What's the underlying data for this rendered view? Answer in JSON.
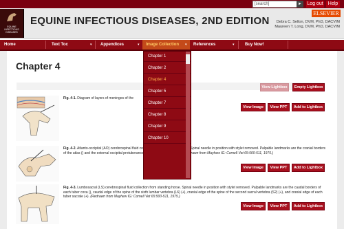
{
  "topbar": {
    "search_placeholder": "[search]",
    "search_go": "►",
    "logout_label": "Log out",
    "help_label": "Help"
  },
  "header": {
    "cover_text": "EQUINE INFECTIOUS DISEASES",
    "title": "EQUINE INFECTIOUS DISEASES, 2ND EDITION",
    "publisher": "ELSEVIER",
    "author1": "Debra C. Sellon, DVM, PhD, DACVIM",
    "author2": "Maureen T. Long, DVM, PhD, DACVIM"
  },
  "nav": {
    "home": "Home",
    "text_toc": "Text Toc",
    "appendices": "Appendices",
    "image_collection": "Image Collection",
    "references": "References",
    "buy_now": "Buy Now!"
  },
  "dropdown": {
    "items": [
      "Chapter 1",
      "Chapter 2",
      "Chapter 4",
      "Chapter 5",
      "Chapter 7",
      "Chapter 8",
      "Chapter 9",
      "Chapter 10"
    ]
  },
  "main": {
    "chapter_title": "Chapter 4",
    "view_lightbox": "View Lightbox",
    "empty_lightbox": "Empty Lightbox",
    "view_image": "View Image",
    "view_ppt": "View PPT",
    "add_to_lightbox": "Add to Lightbox",
    "fig1_label": "Fig. 4-1.",
    "fig1_text": "Diagram of layers of meninges of the",
    "fig2_label": "Fig. 4-2.",
    "fig2_text": "Atlanto-occipital (AO) cerebrospinal fluid collection from recumbent horse. Spinal needle in position with stylet removed. Palpable landmarks are the cranial borders of the atlas () and the external occipital protuberance (+) on the dorsal midline.",
    "fig2_credit": "(Redrawn from Mayhew IG: Cornell Vet 65:500-511, 1975.)",
    "fig3_label": "Fig. 4-3.",
    "fig3_text": "Lumbosacral (LS) cerebrospinal fluid collection from standing horse. Spinal needle in position with stylet removed. Palpable landmarks are the caudal borders of each tuber coxa (), caudal edge of the spine of the sixth lumbar vertebra (L6) (+), cranial edge of the spine of the second sacral vertebra (S2) (+), and cranial edge of each tuber sacrale (+).",
    "fig3_credit": "(Redrawn from Mayhew IG: Cornell Vet 65:500-511, 1975.)"
  },
  "colors": {
    "brand_red": "#8e0a14",
    "button_red": "#a8101e",
    "elsevier_orange": "#e64a00",
    "active_menu": "#ffb24a"
  }
}
